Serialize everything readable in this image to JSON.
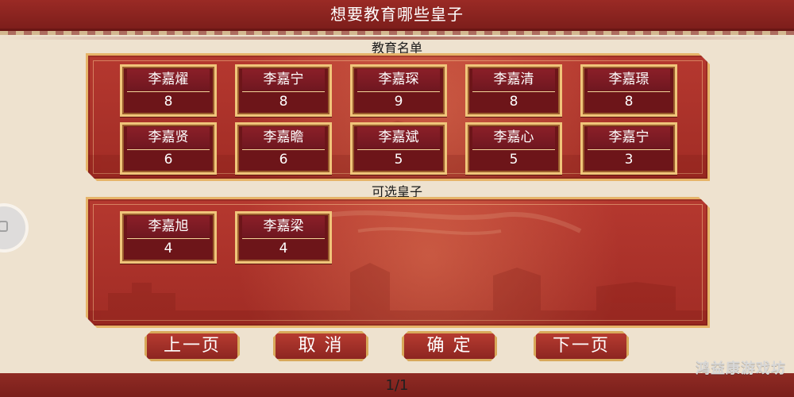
{
  "header": {
    "title": "想要教育哪些皇子"
  },
  "sections": {
    "education_list_label": "教育名单",
    "available_label": "可选皇子"
  },
  "education_list": [
    {
      "name": "李嘉燿",
      "value": "8"
    },
    {
      "name": "李嘉宁",
      "value": "8"
    },
    {
      "name": "李嘉琛",
      "value": "9"
    },
    {
      "name": "李嘉清",
      "value": "8"
    },
    {
      "name": "李嘉璟",
      "value": "8"
    },
    {
      "name": "李嘉贤",
      "value": "6"
    },
    {
      "name": "李嘉瞻",
      "value": "6"
    },
    {
      "name": "李嘉斌",
      "value": "5"
    },
    {
      "name": "李嘉心",
      "value": "5"
    },
    {
      "name": "李嘉宁",
      "value": "3"
    }
  ],
  "available_list": [
    {
      "name": "李嘉旭",
      "value": "4"
    },
    {
      "name": "李嘉梁",
      "value": "4"
    }
  ],
  "buttons": {
    "prev": "上一页",
    "cancel": "取 消",
    "confirm": "确 定",
    "next": "下一页"
  },
  "pagination": {
    "label": "1/1"
  },
  "watermark": {
    "text": "鸿益康游戏坊"
  },
  "colors": {
    "accent_red": "#a12c25",
    "gold": "#e6b469",
    "bg": "#eee2cf"
  },
  "icons": {
    "side_handle": "lock-icon"
  }
}
